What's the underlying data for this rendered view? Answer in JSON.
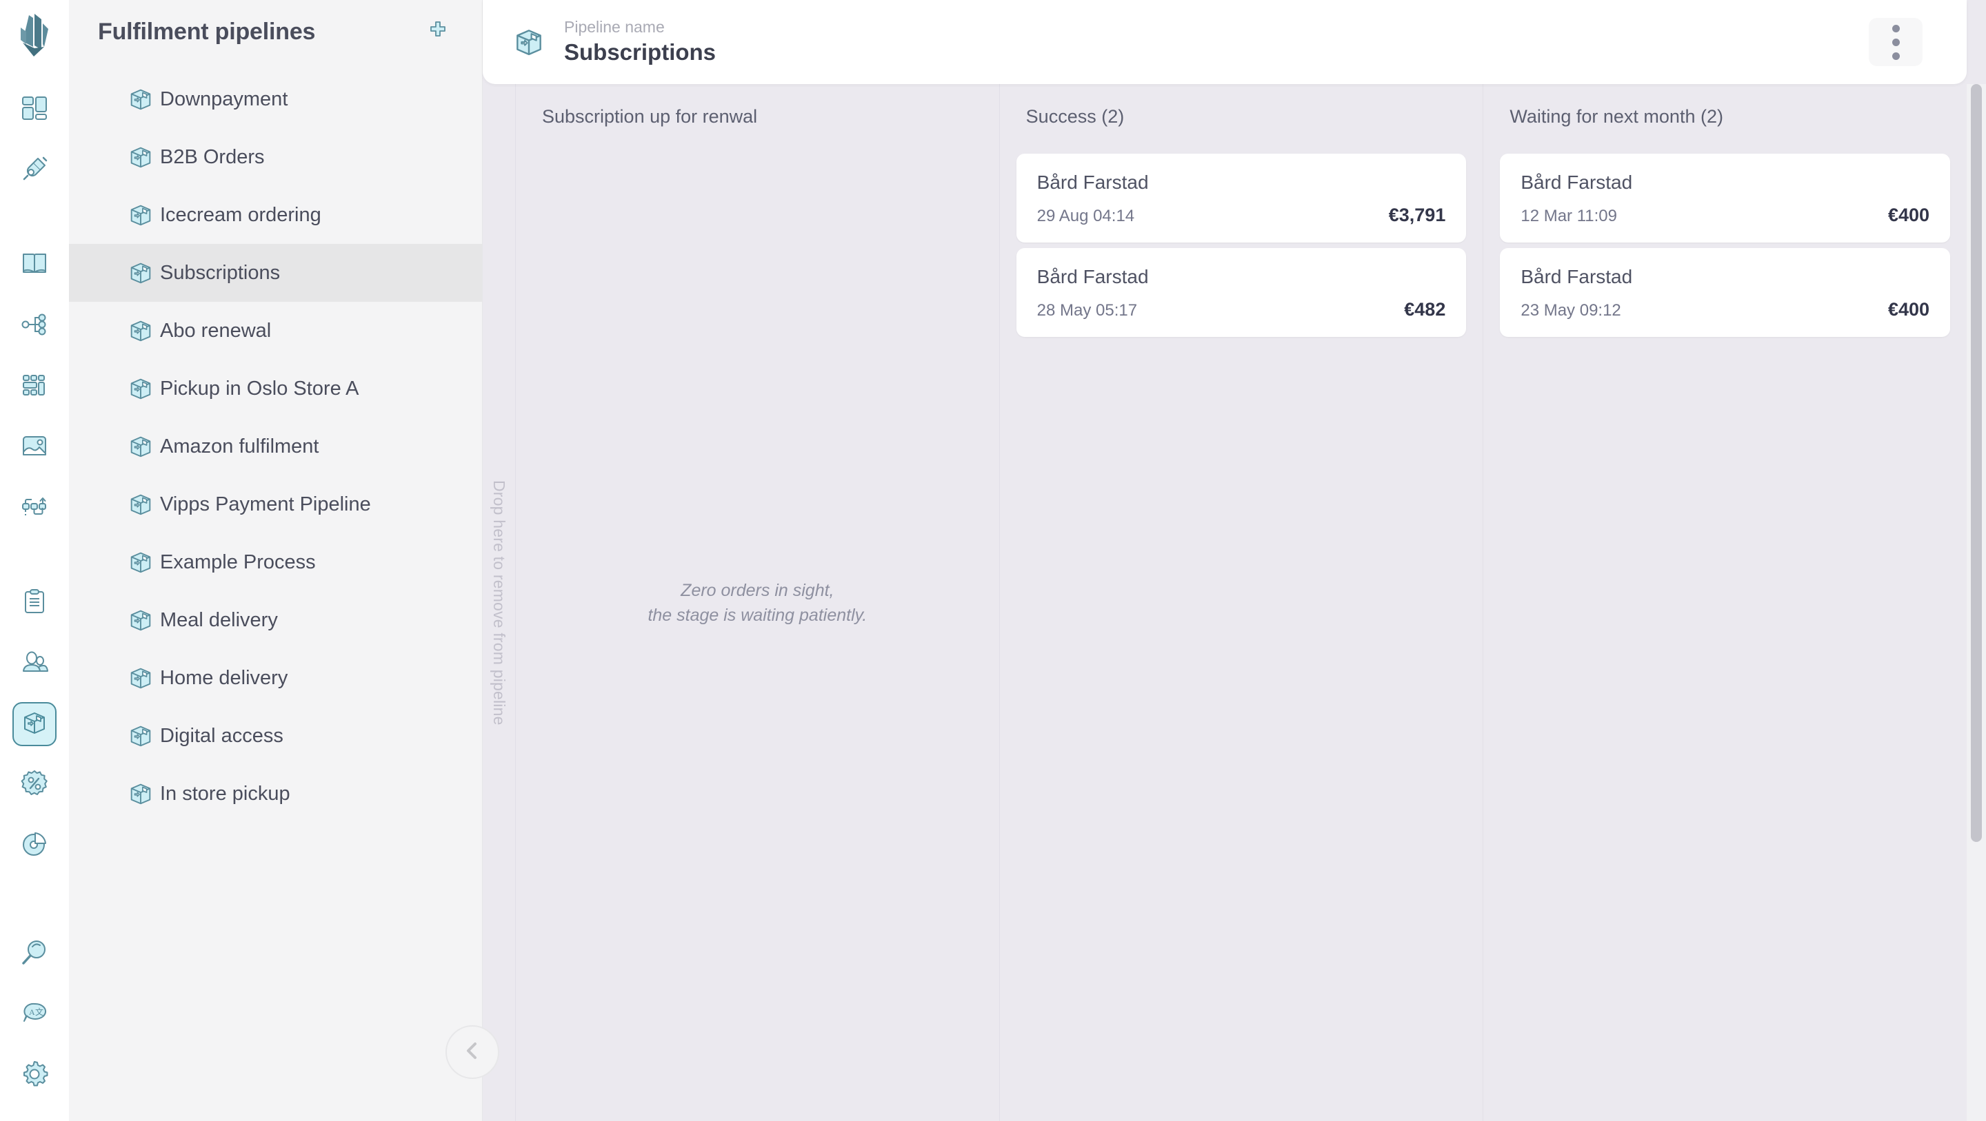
{
  "rail": {
    "logo_name": "app-logo",
    "items": [
      {
        "name": "dashboard-icon",
        "active": false
      },
      {
        "name": "integrations-plug-icon",
        "active": false
      },
      {
        "name": "catalog-book-icon",
        "active": false
      },
      {
        "name": "hierarchy-icon",
        "active": false
      },
      {
        "name": "blocks-grid-icon",
        "active": false
      },
      {
        "name": "media-image-icon",
        "active": false
      },
      {
        "name": "workflow-icon",
        "active": false
      },
      {
        "name": "orders-clipboard-icon",
        "active": false
      },
      {
        "name": "customers-people-icon",
        "active": false
      },
      {
        "name": "pipelines-package-icon",
        "active": true
      },
      {
        "name": "discounts-percent-icon",
        "active": false
      },
      {
        "name": "analytics-pie-icon",
        "active": false
      },
      {
        "name": "search-magnifier-icon",
        "active": false
      },
      {
        "name": "translations-icon",
        "active": false
      },
      {
        "name": "settings-gear-icon",
        "active": false
      }
    ]
  },
  "sidebar": {
    "title": "Fulfilment pipelines",
    "add_button_label": "+",
    "collapse_button_label": "‹",
    "items": [
      {
        "label": "Downpayment",
        "selected": false
      },
      {
        "label": "B2B Orders",
        "selected": false
      },
      {
        "label": "Icecream ordering",
        "selected": false
      },
      {
        "label": "Subscriptions",
        "selected": true
      },
      {
        "label": "Abo renewal",
        "selected": false
      },
      {
        "label": "Pickup in Oslo Store A",
        "selected": false
      },
      {
        "label": "Amazon fulfilment",
        "selected": false
      },
      {
        "label": "Vipps Payment Pipeline",
        "selected": false
      },
      {
        "label": "Example Process",
        "selected": false
      },
      {
        "label": "Meal delivery",
        "selected": false
      },
      {
        "label": "Home delivery",
        "selected": false
      },
      {
        "label": "Digital access",
        "selected": false
      },
      {
        "label": "In store pickup",
        "selected": false
      }
    ]
  },
  "header": {
    "kicker": "Pipeline name",
    "title": "Subscriptions",
    "menu_label": "more-options"
  },
  "board": {
    "dropzone_label": "Drop here to remove from pipeline",
    "empty_state_line1": "Zero orders in sight,",
    "empty_state_line2": "the stage is waiting patiently.",
    "columns": [
      {
        "title": "Subscription up for renwal",
        "count": null,
        "empty": true,
        "cards": []
      },
      {
        "title": "Success (2)",
        "count": 2,
        "empty": false,
        "cards": [
          {
            "name": "Bård Farstad",
            "date": "29 Aug 04:14",
            "amount": "€3,791"
          },
          {
            "name": "Bård Farstad",
            "date": "28 May 05:17",
            "amount": "€482"
          }
        ]
      },
      {
        "title": "Waiting for next month (2)",
        "count": 2,
        "empty": false,
        "cards": [
          {
            "name": "Bård Farstad",
            "date": "12 Mar 11:09",
            "amount": "€400"
          },
          {
            "name": "Bård Farstad",
            "date": "23 May 09:12",
            "amount": "€400"
          }
        ]
      }
    ]
  },
  "colors": {
    "icon_fill": "#cdeef5",
    "icon_stroke": "#5a8e9e",
    "board_bg": "#ebe9ef",
    "sidebar_bg": "#f4f4f5",
    "selected_bg": "#e6e6e7",
    "text_dark": "#4a4d5c"
  }
}
